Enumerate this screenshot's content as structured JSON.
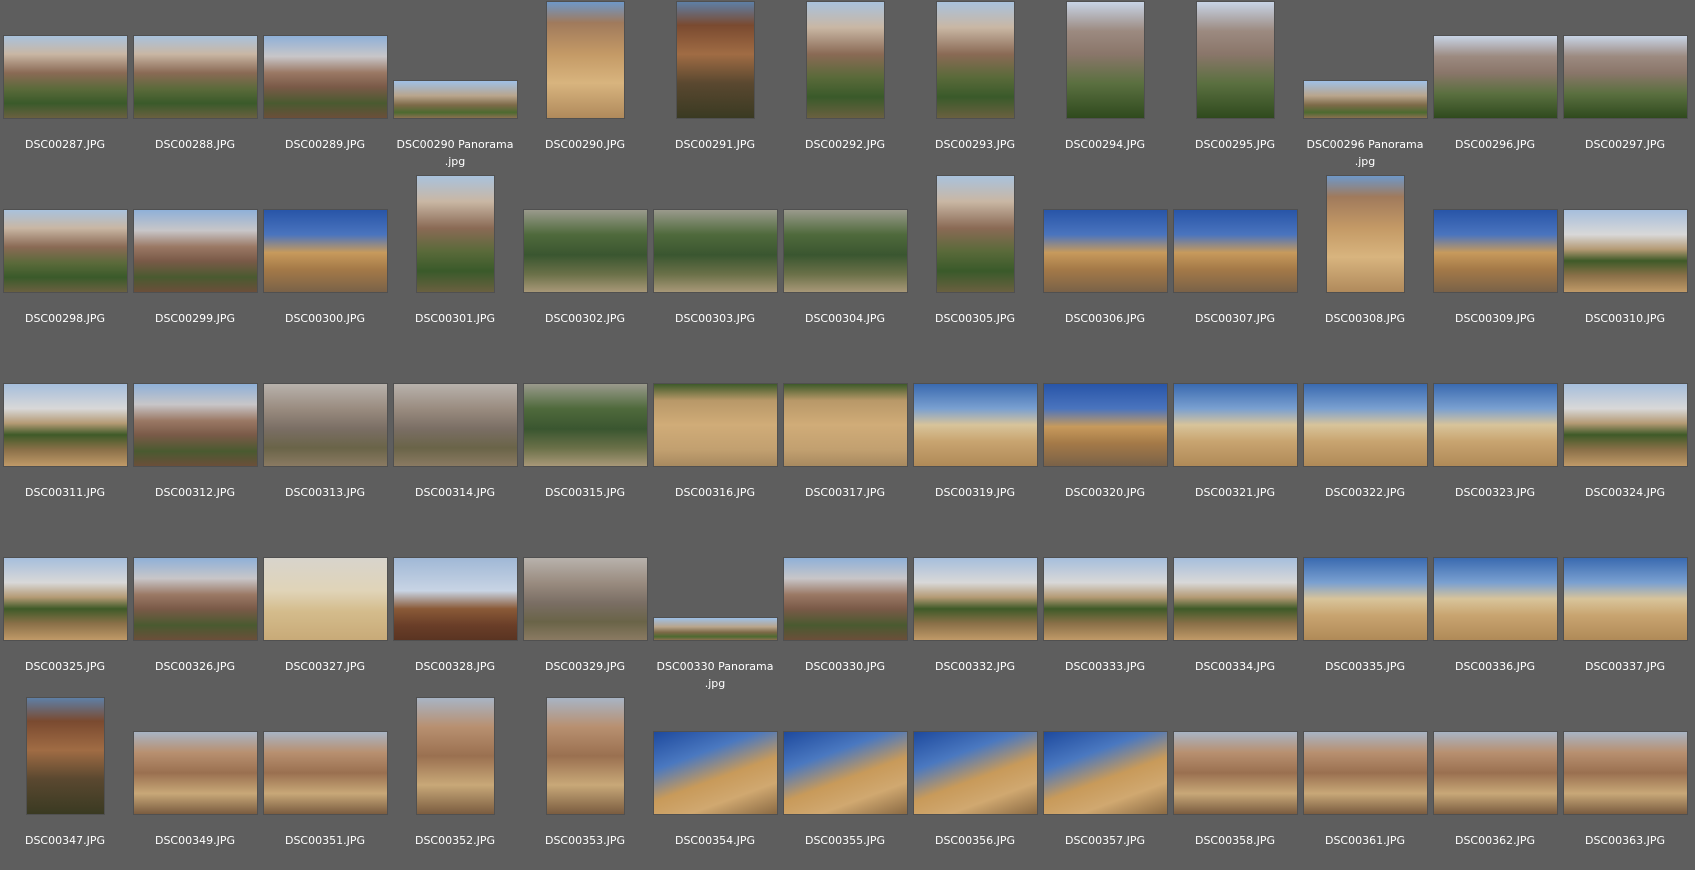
{
  "thumbnails": [
    {
      "name": "DSC00287.JPG",
      "shape": "landscape",
      "scene": "canyon-palms"
    },
    {
      "name": "DSC00288.JPG",
      "shape": "landscape",
      "scene": "canyon-palms"
    },
    {
      "name": "DSC00289.JPG",
      "shape": "landscape",
      "scene": "mountains"
    },
    {
      "name": "DSC00290 Panorama\n.jpg",
      "shape": "pano",
      "scene": "pano"
    },
    {
      "name": "DSC00290.JPG",
      "shape": "portrait",
      "scene": "gorge"
    },
    {
      "name": "DSC00291.JPG",
      "shape": "portrait",
      "scene": "gorge-dark"
    },
    {
      "name": "DSC00292.JPG",
      "shape": "portrait",
      "scene": "canyon-palms"
    },
    {
      "name": "DSC00293.JPG",
      "shape": "portrait",
      "scene": "canyon-palms"
    },
    {
      "name": "DSC00294.JPG",
      "shape": "portrait",
      "scene": "palms-hill"
    },
    {
      "name": "DSC00295.JPG",
      "shape": "portrait",
      "scene": "palms-hill"
    },
    {
      "name": "DSC00296 Panorama\n.jpg",
      "shape": "pano",
      "scene": "pano"
    },
    {
      "name": "DSC00296.JPG",
      "shape": "landscape",
      "scene": "palms-hill"
    },
    {
      "name": "DSC00297.JPG",
      "shape": "landscape",
      "scene": "palms-hill"
    },
    {
      "name": "DSC00298.JPG",
      "shape": "landscape",
      "scene": "canyon-palms"
    },
    {
      "name": "DSC00299.JPG",
      "shape": "landscape",
      "scene": "mountains"
    },
    {
      "name": "DSC00300.JPG",
      "shape": "landscape",
      "scene": "ruins-blue"
    },
    {
      "name": "DSC00301.JPG",
      "shape": "portrait",
      "scene": "canyon-palms"
    },
    {
      "name": "DSC00302.JPG",
      "shape": "landscape",
      "scene": "palm-grove"
    },
    {
      "name": "DSC00303.JPG",
      "shape": "landscape",
      "scene": "palm-grove"
    },
    {
      "name": "DSC00304.JPG",
      "shape": "landscape",
      "scene": "palm-grove"
    },
    {
      "name": "DSC00305.JPG",
      "shape": "portrait",
      "scene": "canyon-palms"
    },
    {
      "name": "DSC00306.JPG",
      "shape": "landscape",
      "scene": "ruins-blue"
    },
    {
      "name": "DSC00307.JPG",
      "shape": "landscape",
      "scene": "ruins-blue"
    },
    {
      "name": "DSC00308.JPG",
      "shape": "portrait",
      "scene": "gorge"
    },
    {
      "name": "DSC00309.JPG",
      "shape": "landscape",
      "scene": "ruins-blue"
    },
    {
      "name": "DSC00310.JPG",
      "shape": "landscape",
      "scene": "oasis-plain"
    },
    {
      "name": "DSC00311.JPG",
      "shape": "landscape",
      "scene": "oasis-plain"
    },
    {
      "name": "DSC00312.JPG",
      "shape": "landscape",
      "scene": "mountains"
    },
    {
      "name": "DSC00313.JPG",
      "shape": "landscape",
      "scene": "rock-gray"
    },
    {
      "name": "DSC00314.JPG",
      "shape": "landscape",
      "scene": "rock-gray"
    },
    {
      "name": "DSC00315.JPG",
      "shape": "landscape",
      "scene": "palm-grove"
    },
    {
      "name": "DSC00316.JPG",
      "shape": "landscape",
      "scene": "wall"
    },
    {
      "name": "DSC00317.JPG",
      "shape": "landscape",
      "scene": "wall"
    },
    {
      "name": "DSC00319.JPG",
      "shape": "landscape",
      "scene": "desert"
    },
    {
      "name": "DSC00320.JPG",
      "shape": "landscape",
      "scene": "ruins-blue"
    },
    {
      "name": "DSC00321.JPG",
      "shape": "landscape",
      "scene": "desert"
    },
    {
      "name": "DSC00322.JPG",
      "shape": "landscape",
      "scene": "desert"
    },
    {
      "name": "DSC00323.JPG",
      "shape": "landscape",
      "scene": "desert"
    },
    {
      "name": "DSC00324.JPG",
      "shape": "landscape",
      "scene": "oasis-plain"
    },
    {
      "name": "DSC00325.JPG",
      "shape": "landscape",
      "scene": "oasis-plain"
    },
    {
      "name": "DSC00326.JPG",
      "shape": "landscape",
      "scene": "mountains"
    },
    {
      "name": "DSC00327.JPG",
      "shape": "landscape",
      "scene": "desert-pale"
    },
    {
      "name": "DSC00328.JPG",
      "shape": "landscape",
      "scene": "ram"
    },
    {
      "name": "DSC00329.JPG",
      "shape": "landscape",
      "scene": "rock-gray"
    },
    {
      "name": "DSC00330 Panorama\n.jpg",
      "shape": "panoshort",
      "scene": "pano"
    },
    {
      "name": "DSC00330.JPG",
      "shape": "landscape",
      "scene": "mountains"
    },
    {
      "name": "DSC00332.JPG",
      "shape": "landscape",
      "scene": "oasis-plain"
    },
    {
      "name": "DSC00333.JPG",
      "shape": "landscape",
      "scene": "oasis-plain"
    },
    {
      "name": "DSC00334.JPG",
      "shape": "landscape",
      "scene": "oasis-plain"
    },
    {
      "name": "DSC00335.JPG",
      "shape": "landscape",
      "scene": "desert"
    },
    {
      "name": "DSC00336.JPG",
      "shape": "landscape",
      "scene": "desert"
    },
    {
      "name": "DSC00337.JPG",
      "shape": "landscape",
      "scene": "desert"
    },
    {
      "name": "DSC00347.JPG",
      "shape": "portrait",
      "scene": "gorge-dark"
    },
    {
      "name": "DSC00349.JPG",
      "shape": "landscape",
      "scene": "canyon-rock"
    },
    {
      "name": "DSC00351.JPG",
      "shape": "landscape",
      "scene": "canyon-rock"
    },
    {
      "name": "DSC00352.JPG",
      "shape": "portrait",
      "scene": "canyon-rock"
    },
    {
      "name": "DSC00353.JPG",
      "shape": "portrait",
      "scene": "canyon-rock"
    },
    {
      "name": "DSC00354.JPG",
      "shape": "landscape",
      "scene": "rock-blue"
    },
    {
      "name": "DSC00355.JPG",
      "shape": "landscape",
      "scene": "rock-blue"
    },
    {
      "name": "DSC00356.JPG",
      "shape": "landscape",
      "scene": "rock-blue"
    },
    {
      "name": "DSC00357.JPG",
      "shape": "landscape",
      "scene": "rock-blue"
    },
    {
      "name": "DSC00358.JPG",
      "shape": "landscape",
      "scene": "canyon-rock"
    },
    {
      "name": "DSC00361.JPG",
      "shape": "landscape",
      "scene": "canyon-rock"
    },
    {
      "name": "DSC00362.JPG",
      "shape": "landscape",
      "scene": "canyon-rock"
    },
    {
      "name": "DSC00363.JPG",
      "shape": "landscape",
      "scene": "canyon-rock"
    }
  ]
}
